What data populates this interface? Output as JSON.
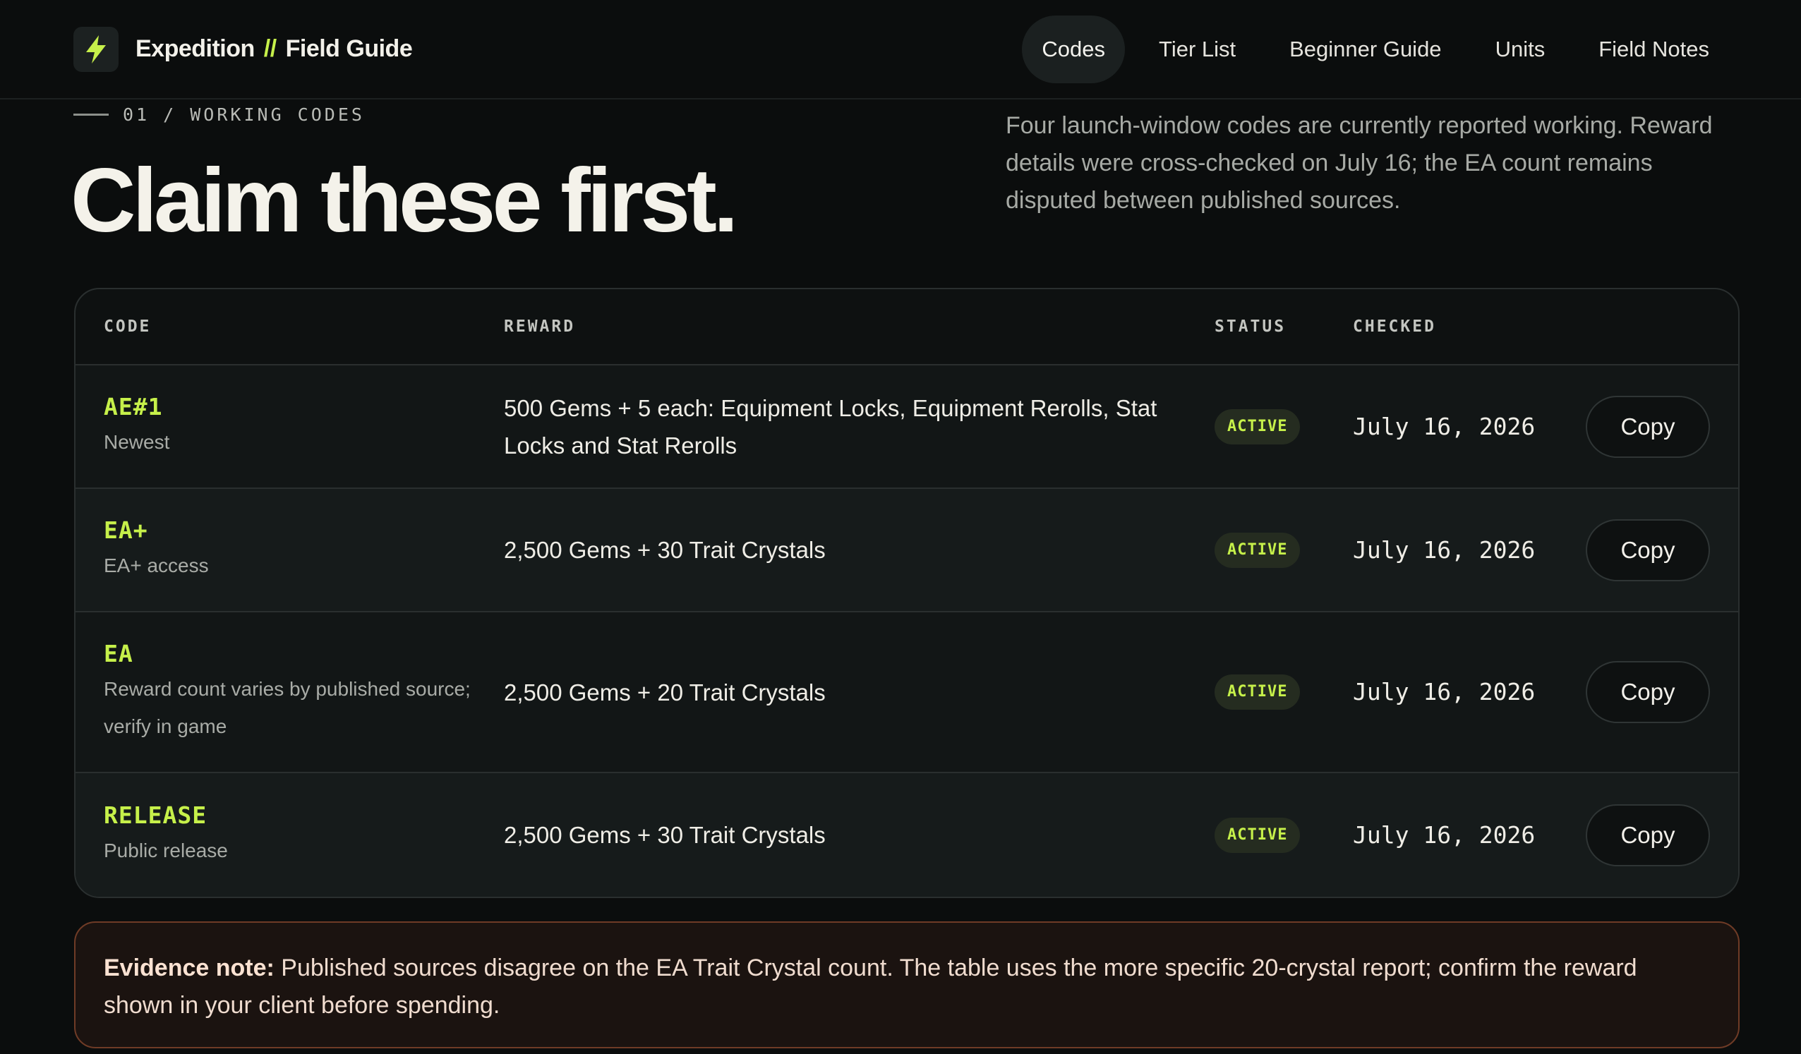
{
  "header": {
    "brand_left": "Expedition",
    "brand_sep": "//",
    "brand_right": "Field Guide",
    "nav": [
      "Codes",
      "Tier List",
      "Beginner Guide",
      "Units",
      "Field Notes"
    ],
    "active_nav": "Codes"
  },
  "intro": {
    "eyebrow": "01 / WORKING CODES",
    "headline": "Claim these first.",
    "description": "Four launch-window codes are currently reported working. Reward details were cross-checked on July 16; the EA count remains disputed between published sources."
  },
  "table": {
    "headers": {
      "code": "CODE",
      "reward": "REWARD",
      "status": "STATUS",
      "checked": "CHECKED"
    },
    "rows": [
      {
        "code": "AE#1",
        "note": "Newest",
        "reward": "500 Gems + 5 each: Equipment Locks, Equipment Rerolls, Stat Locks and Stat Rerolls",
        "status": "ACTIVE",
        "checked": "July 16, 2026",
        "action": "Copy"
      },
      {
        "code": "EA+",
        "note": "EA+ access",
        "reward": "2,500 Gems + 30 Trait Crystals",
        "status": "ACTIVE",
        "checked": "July 16, 2026",
        "action": "Copy"
      },
      {
        "code": "EA",
        "note": "Reward count varies by published source; verify in game",
        "reward": "2,500 Gems + 20 Trait Crystals",
        "status": "ACTIVE",
        "checked": "July 16, 2026",
        "action": "Copy"
      },
      {
        "code": "RELEASE",
        "note": "Public release",
        "reward": "2,500 Gems + 30 Trait Crystals",
        "status": "ACTIVE",
        "checked": "July 16, 2026",
        "action": "Copy"
      }
    ]
  },
  "evidence": {
    "label": "Evidence note:",
    "text": "Published sources disagree on the EA Trait Crystal count. The table uses the more specific 20-crystal report; confirm the reward shown in your client before spending."
  },
  "colors": {
    "accent": "#c6f04a",
    "background": "#0b0d0d",
    "note_border": "#6f3b26"
  },
  "icons": {
    "logo": "lightning-bolt-icon"
  }
}
